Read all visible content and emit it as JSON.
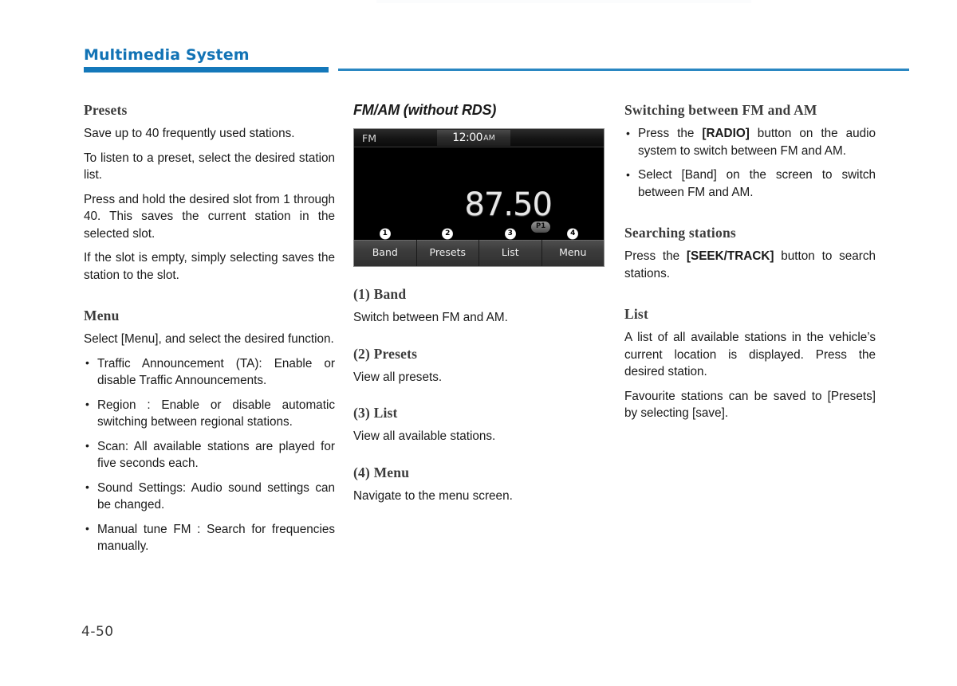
{
  "header": {
    "title": "Multimedia System",
    "accent_color": "#1478ba"
  },
  "footer": {
    "page_number": "4-50"
  },
  "column_1": {
    "presets": {
      "heading": "Presets",
      "paragraphs": [
        "Save up to 40 frequently used stations.",
        "To listen to a preset, select the desired station list.",
        "Press and hold the desired slot from 1 through 40. This saves the current station in the selected slot.",
        "If the slot is empty, simply selecting saves the station to the slot."
      ]
    },
    "menu": {
      "heading": "Menu",
      "intro": "Select [Menu], and select the desired function.",
      "bullets": [
        "Traffic Announcement (TA): Enable or disable Traffic Announcements.",
        "Region : Enable or disable automatic switching between regional stations.",
        "Scan: All available stations are played for five seconds each.",
        "Sound Settings: Audio sound settings can be changed.",
        "Manual tune FM : Search for frequencies manually."
      ]
    }
  },
  "column_2": {
    "heading": "FM/AM (without RDS)",
    "device_screen": {
      "band_label": "FM",
      "clock_time": "12:00",
      "clock_ampm": "AM",
      "frequency": "87.50",
      "preset_badge": "P1",
      "buttons": [
        {
          "callout": "❶",
          "number": "1",
          "label": "Band"
        },
        {
          "callout": "❷",
          "number": "2",
          "label": "Presets"
        },
        {
          "callout": "❸",
          "number": "3",
          "label": "List"
        },
        {
          "callout": "❹",
          "number": "4",
          "label": "Menu"
        }
      ]
    },
    "items": [
      {
        "heading": "(1) Band",
        "text": "Switch between FM and AM."
      },
      {
        "heading": "(2) Presets",
        "text": "View all presets."
      },
      {
        "heading": "(3) List",
        "text": "View all available stations."
      },
      {
        "heading": "(4) Menu",
        "text": "Navigate to the menu screen."
      }
    ]
  },
  "column_3": {
    "switching": {
      "heading": "Switching between FM and AM",
      "bullet_1_pre": "Press the ",
      "bullet_1_bold": "[RADIO]",
      "bullet_1_post": " button on the audio system to switch between FM and AM.",
      "bullet_2": "Select [Band] on the screen to switch between FM and AM."
    },
    "searching": {
      "heading": "Searching stations",
      "text_pre": "Press the ",
      "text_bold": "[SEEK/TRACK]",
      "text_post": " button to search stations."
    },
    "list": {
      "heading": "List",
      "paragraphs": [
        "A list of all available stations in the vehicle’s current location is displayed. Press the desired station.",
        "Favourite stations can be saved to [Presets] by selecting [save]."
      ]
    }
  }
}
